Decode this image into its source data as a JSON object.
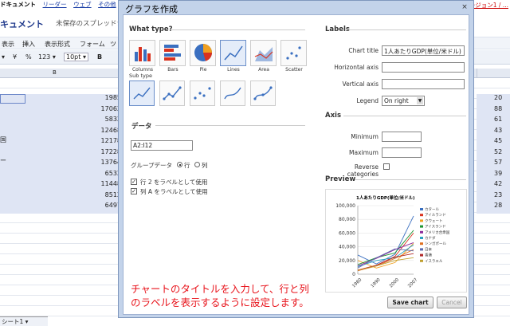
{
  "background": {
    "topbar": [
      "ドキュメント",
      "リーダー",
      "ウェブ",
      "その他"
    ],
    "top_right_link": "バージョン1 / ...",
    "doc_title": "キュメント",
    "doc_subtitle": "未保存のスプレッドシ",
    "menu": [
      "表示",
      "挿入",
      "表示形式",
      "フォーム",
      "ツ"
    ],
    "toolbar": [
      "▾",
      "¥",
      "%",
      "123 ▾",
      "10pt ▾",
      "B"
    ],
    "column_b": "B",
    "left_labels": [
      "国",
      "ー"
    ],
    "values_b": [
      "1985",
      "17062",
      "5832",
      "12468",
      "12178",
      "17228",
      "13764",
      "6532",
      "11448",
      "8512",
      "6497"
    ],
    "values_right": [
      "20",
      "88",
      "61",
      "43",
      "45",
      "52",
      "57",
      "39",
      "42",
      "23",
      "28"
    ],
    "sheet_tab": "シート1 ▾"
  },
  "dialog": {
    "title": "グラフを作成",
    "close": "×",
    "what_type": "What type?",
    "types": [
      {
        "label": "Columns",
        "icon": "column-chart-icon"
      },
      {
        "label": "Bars",
        "icon": "bar-chart-icon"
      },
      {
        "label": "Pie",
        "icon": "pie-chart-icon"
      },
      {
        "label": "Lines",
        "icon": "line-chart-icon"
      },
      {
        "label": "Area",
        "icon": "area-chart-icon"
      },
      {
        "label": "Scatter",
        "icon": "scatter-chart-icon"
      }
    ],
    "sub_type": "Sub type",
    "data_section": "データ",
    "data_range": "A2:I12",
    "group_label": "グループデータ",
    "group_row": "行",
    "group_col": "列",
    "chk_row_label": "行 2 をラベルとして使用",
    "chk_col_label": "列 A をラベルとして使用",
    "labels_section": "Labels",
    "chart_title_label": "Chart title",
    "chart_title_value": "1人あたりGDP(単位/米ドル)",
    "h_axis_label": "Horizontal axis",
    "v_axis_label": "Vertical axis",
    "legend_label": "Legend",
    "legend_value": "On right",
    "axis_section": "Axis",
    "minimum_label": "Minimum",
    "maximum_label": "Maximum",
    "reverse_label": "Reverse categories",
    "preview_section": "Preview",
    "save_button": "Save chart",
    "cancel_button": "Cancel",
    "caption_line1": "チャートのタイトルを入力して、行と列",
    "caption_line2": "のラベルを表示するように設定します。"
  },
  "chart_data": {
    "type": "line",
    "title": "1人あたりGDP(単位/米ドル)",
    "ylim": [
      0,
      100000
    ],
    "yticks": [
      "0",
      "20,000",
      "40,000",
      "60,000",
      "80,000",
      "100,000"
    ],
    "x": [
      "1980",
      "1990",
      "2000",
      "2007"
    ],
    "legend_position": "right",
    "series": [
      {
        "name": "カタール",
        "color": "#3a6fc0",
        "values": [
          28000,
          15000,
          29000,
          85000
        ]
      },
      {
        "name": "アイルランド",
        "color": "#d9321f",
        "values": [
          6000,
          13000,
          26000,
          60000
        ]
      },
      {
        "name": "クウェート",
        "color": "#f0a020",
        "values": [
          20000,
          9000,
          17000,
          45000
        ]
      },
      {
        "name": "アイスランド",
        "color": "#1e9632",
        "values": [
          14000,
          24000,
          31000,
          64000
        ]
      },
      {
        "name": "アメリカ合衆国",
        "color": "#8a2a9a",
        "values": [
          12000,
          23000,
          36000,
          46000
        ]
      },
      {
        "name": "カナダ",
        "color": "#2aa0c0",
        "values": [
          11000,
          20000,
          24000,
          43000
        ]
      },
      {
        "name": "シンガポール",
        "color": "#e07020",
        "values": [
          5000,
          12000,
          23000,
          36000
        ]
      },
      {
        "name": "日本",
        "color": "#5a6ab0",
        "values": [
          9000,
          24000,
          37000,
          34000
        ]
      },
      {
        "name": "香港",
        "color": "#b02a2a",
        "values": [
          5500,
          13000,
          25000,
          30000
        ]
      },
      {
        "name": "イスラエル",
        "color": "#c0a030",
        "values": [
          5600,
          12000,
          20000,
          24000
        ]
      }
    ]
  }
}
